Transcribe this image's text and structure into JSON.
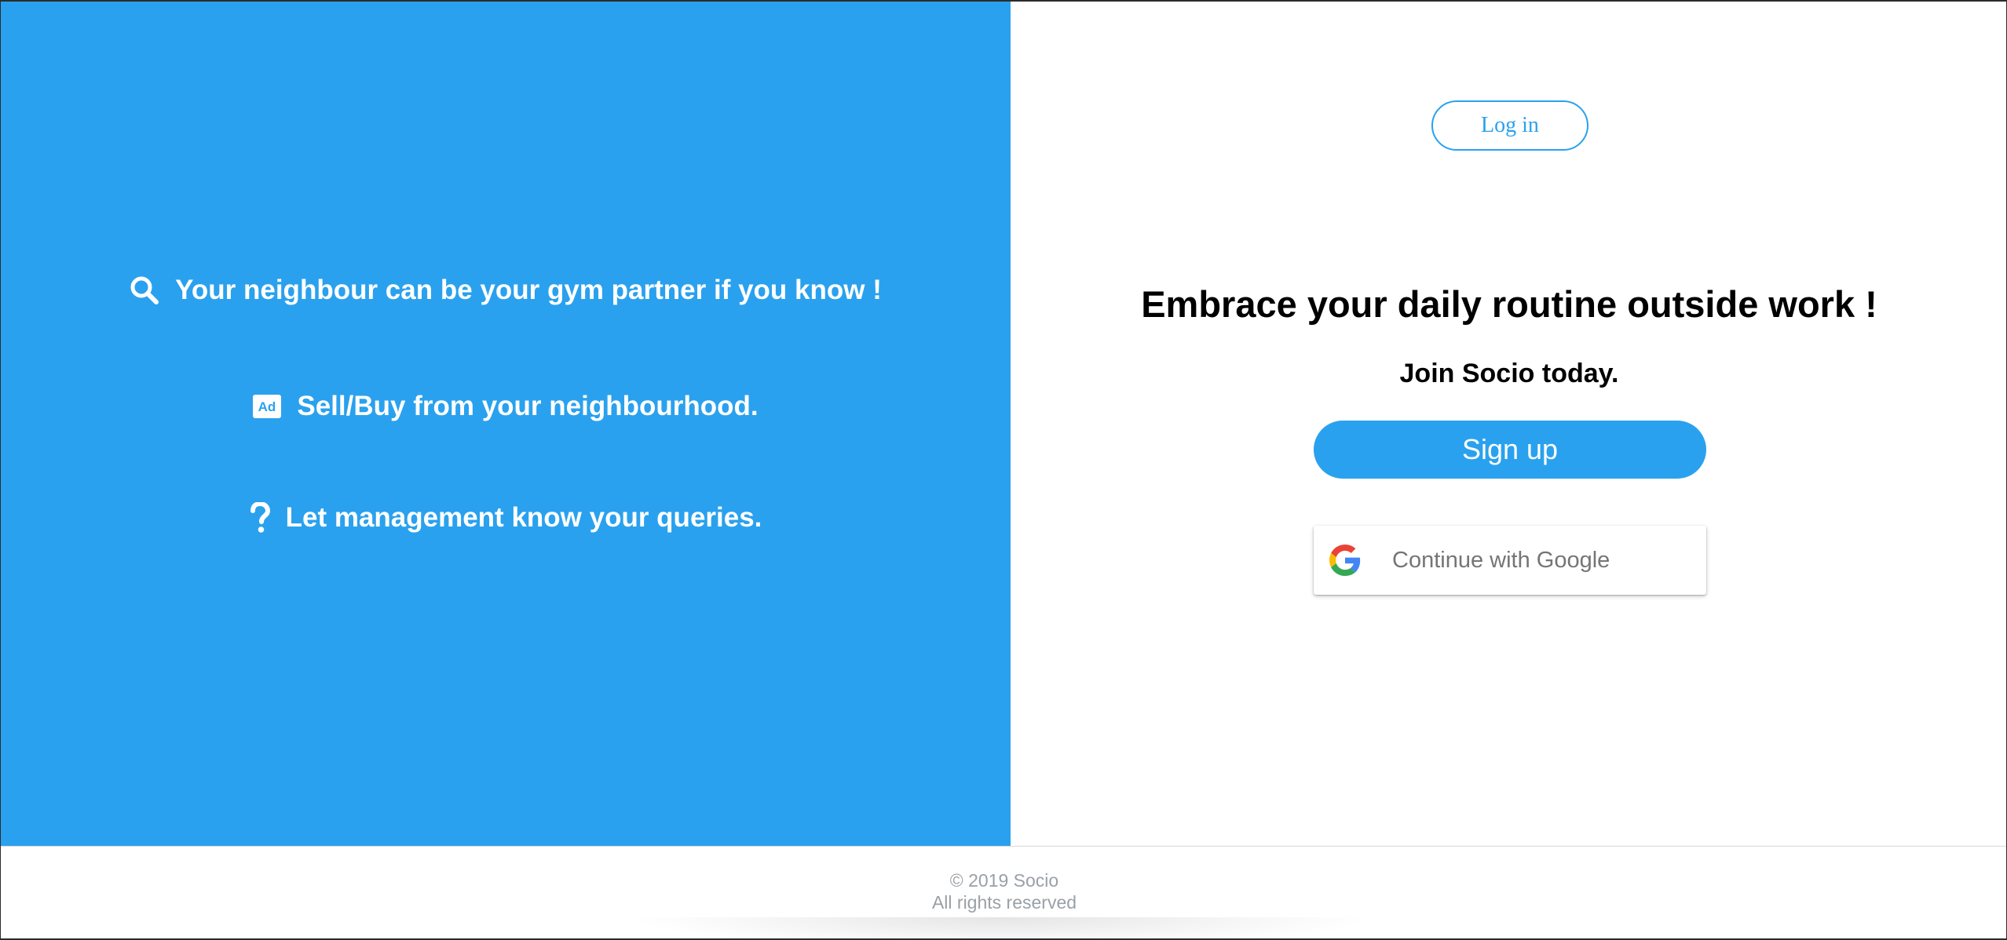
{
  "features": [
    {
      "icon": "search-icon",
      "text": "Your neighbour can be your gym partner if you know !"
    },
    {
      "icon": "ad-icon",
      "icon_text": "Ad",
      "text": "Sell/Buy from your neighbourhood."
    },
    {
      "icon": "question-icon",
      "text": "Let management know your queries."
    }
  ],
  "auth": {
    "login_label": "Log in",
    "headline": "Embrace your daily routine outside work !",
    "subheadline": "Join Socio today.",
    "signup_label": "Sign up",
    "google_label": "Continue with Google"
  },
  "footer": {
    "copyright": "© 2019 Socio",
    "rights": "All rights reserved"
  },
  "colors": {
    "brand_blue": "#2aa1ee",
    "footer_text": "#9aa0a6"
  }
}
